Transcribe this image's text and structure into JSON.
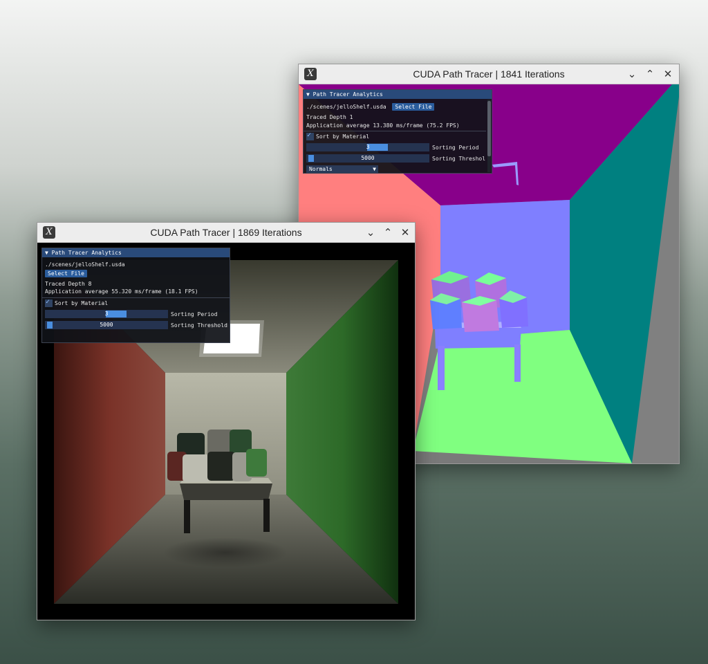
{
  "window_back": {
    "title": "CUDA Path Tracer | 1841 Iterations",
    "app_icon": "X",
    "panel": {
      "header": "▼ Path Tracer Analytics",
      "scene_path": "./scenes/jelloShelf.usda",
      "select_file": "Select File",
      "traced_depth": "Traced Depth 1",
      "app_average": "Application average 13.380 ms/frame (75.2 FPS)",
      "sort_by_material": "Sort by Material",
      "sorting_period_value": "3",
      "sorting_period_label": "Sorting Period",
      "sorting_threshold_value": "5000",
      "sorting_threshold_label": "Sorting Threshol",
      "display_mode": "Normals",
      "sort_checked": true
    }
  },
  "window_front": {
    "title": "CUDA Path Tracer | 1869 Iterations",
    "app_icon": "X",
    "panel": {
      "header": "▼ Path Tracer Analytics",
      "scene_path": "./scenes/jelloShelf.usda",
      "select_file": "Select File",
      "traced_depth": "Traced Depth 8",
      "app_average": "Application average 55.320 ms/frame (18.1 FPS)",
      "sort_by_material": "Sort by Material",
      "sorting_period_value": "3",
      "sorting_period_label": "Sorting Period",
      "sorting_threshold_value": "5000",
      "sorting_threshold_label": "Sorting Threshold",
      "sort_checked": true
    }
  },
  "icons": {
    "minimize": "chevron-down-icon",
    "maximize": "chevron-up-icon",
    "close": "close-icon",
    "dropdown": "triangle-down-icon",
    "check": "checkmark-icon"
  },
  "colors": {
    "imgui_header": "#294a7a",
    "imgui_button": "#2a5c9c",
    "slider_grab": "#4a8ee0",
    "normals_magenta": "#8a008a",
    "normals_teal": "#007f7f",
    "normals_salmon": "#ff7f7f",
    "normals_blue": "#7f7fff",
    "normals_green": "#7fff7f"
  }
}
